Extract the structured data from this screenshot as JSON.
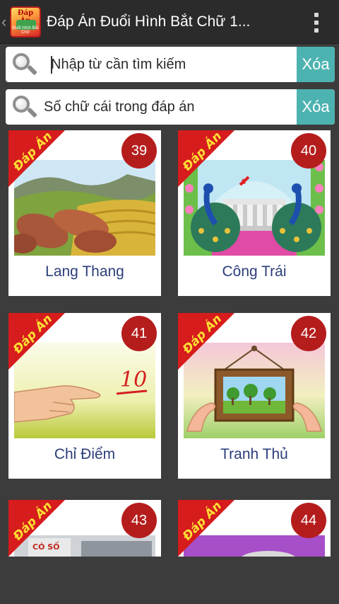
{
  "appbar": {
    "back_glyph": "‹",
    "icon_top_text": "Đáp Án",
    "icon_bottom_text": "Đuổi Hình Bắt Chữ",
    "title": "Đáp Án Đuổi Hình Bắt Chữ 1..."
  },
  "search": {
    "keyword_placeholder": "Nhập từ cần tìm kiếm",
    "letters_placeholder": "Số chữ cái trong đáp án",
    "clear_label_1": "Xóa",
    "clear_label_2": "Xóa"
  },
  "ribbon_text": "Đáp Án",
  "cards": [
    {
      "number": "39",
      "label": "Lang Thang"
    },
    {
      "number": "40",
      "label": "Công Trái"
    },
    {
      "number": "41",
      "label": "Chỉ Điểm"
    },
    {
      "number": "42",
      "label": "Tranh Thủ"
    },
    {
      "number": "43",
      "label": ""
    },
    {
      "number": "44",
      "label": ""
    }
  ],
  "thumb_43_text": "CÓ SỐ",
  "thumb_41_text": "10",
  "colors": {
    "accent": "#4db3b0",
    "badge": "#b51d1d",
    "ribbon": "#d61c1c",
    "label": "#2c3e7a"
  }
}
